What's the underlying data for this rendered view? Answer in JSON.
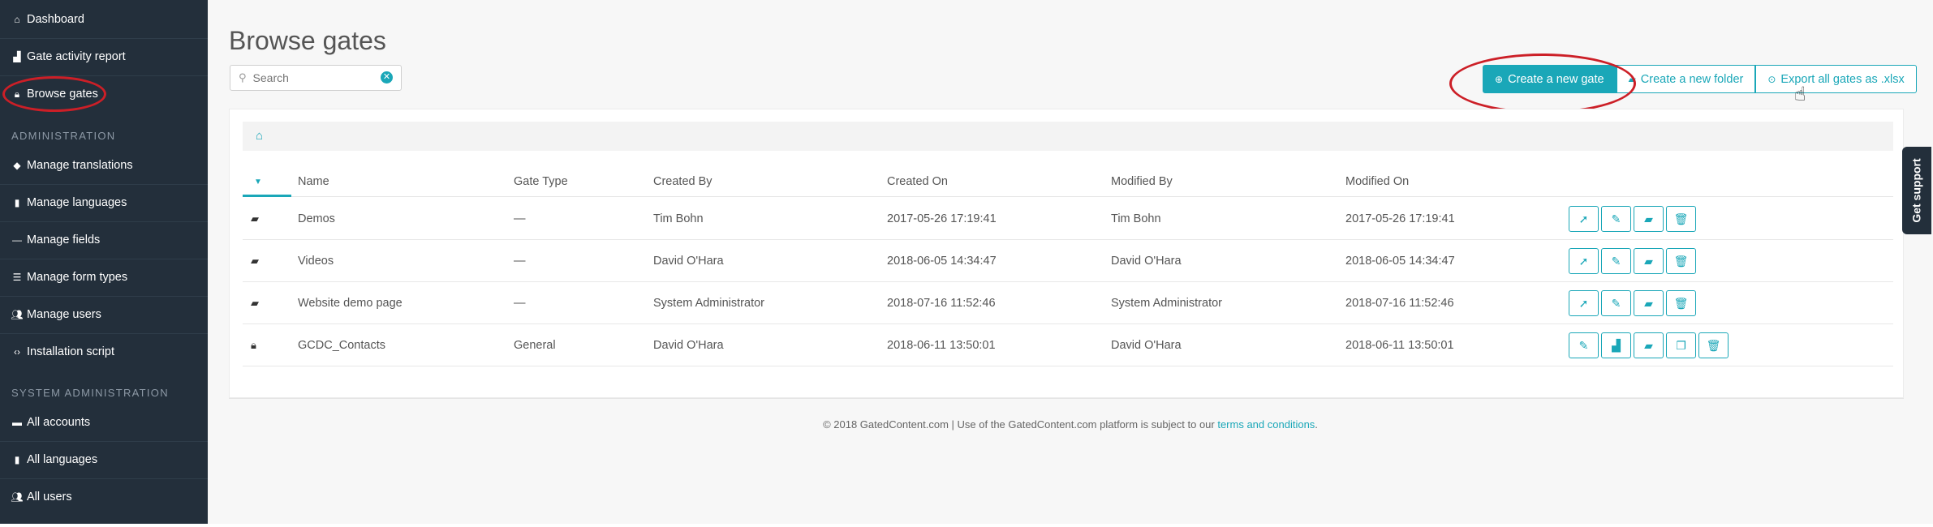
{
  "sidebar": {
    "items": [
      {
        "label": "Dashboard",
        "icon": "home-icon"
      },
      {
        "label": "Gate activity report",
        "icon": "bar-chart-icon"
      },
      {
        "label": "Browse gates",
        "icon": "lock-icon"
      }
    ],
    "admin_heading": "ADMINISTRATION",
    "admin_items": [
      {
        "label": "Manage translations",
        "icon": "language-icon"
      },
      {
        "label": "Manage languages",
        "icon": "book-icon"
      },
      {
        "label": "Manage fields",
        "icon": "dash-icon"
      },
      {
        "label": "Manage form types",
        "icon": "list-icon"
      },
      {
        "label": "Manage users",
        "icon": "users-icon"
      },
      {
        "label": "Installation script",
        "icon": "code-icon"
      }
    ],
    "sysadmin_heading": "SYSTEM ADMINISTRATION",
    "sysadmin_items": [
      {
        "label": "All accounts",
        "icon": "briefcase-icon"
      },
      {
        "label": "All languages",
        "icon": "book-icon"
      },
      {
        "label": "All users",
        "icon": "users-icon"
      }
    ]
  },
  "main": {
    "title": "Browse gates",
    "search": {
      "placeholder": "Search",
      "value": ""
    },
    "buttons": {
      "create_gate": "Create a new gate",
      "create_folder": "Create a new folder",
      "export": "Export all gates as .xlsx"
    },
    "table": {
      "headers": [
        "Name",
        "Gate Type",
        "Created By",
        "Created On",
        "Modified By",
        "Modified On"
      ],
      "rows": [
        {
          "type": "folder",
          "name": "Demos",
          "gate_type": "—",
          "created_by": "Tim Bohn",
          "created_on": "2017-05-26 17:19:41",
          "modified_by": "Tim Bohn",
          "modified_on": "2017-05-26 17:19:41"
        },
        {
          "type": "folder",
          "name": "Videos",
          "gate_type": "—",
          "created_by": "David O'Hara",
          "created_on": "2018-06-05 14:34:47",
          "modified_by": "David O'Hara",
          "modified_on": "2018-06-05 14:34:47"
        },
        {
          "type": "folder",
          "name": "Website demo page",
          "gate_type": "—",
          "created_by": "System Administrator",
          "created_on": "2018-07-16 11:52:46",
          "modified_by": "System Administrator",
          "modified_on": "2018-07-16 11:52:46"
        },
        {
          "type": "gate",
          "name": "GCDC_Contacts",
          "gate_type": "General",
          "created_by": "David O'Hara",
          "created_on": "2018-06-11 13:50:01",
          "modified_by": "David O'Hara",
          "modified_on": "2018-06-11 13:50:01"
        }
      ]
    },
    "footer": {
      "text": "© 2018 GatedContent.com | Use of the GatedContent.com platform is subject to our ",
      "link": "terms and conditions",
      "suffix": "."
    },
    "support_tab": "Get support"
  },
  "colors": {
    "accent": "#1aa7b8",
    "sidebar_bg": "#232f3b",
    "highlight_circle": "#cc1f27"
  }
}
